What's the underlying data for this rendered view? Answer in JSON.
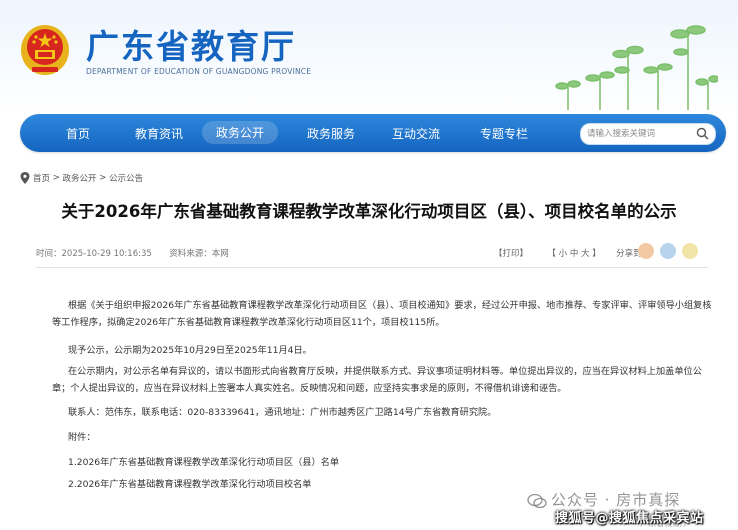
{
  "header": {
    "title": "广东省教育厅",
    "subtitle": "DEPARTMENT OF EDUCATION OF GUANGDONG PROVINCE",
    "brand_color": "#1565c0"
  },
  "nav": {
    "items": [
      "首页",
      "教育资讯",
      "政务公开",
      "政务服务",
      "互动交流",
      "专题专栏"
    ],
    "active": "政务公开",
    "search_placeholder": "请输入搜索关键词"
  },
  "breadcrumb": [
    "首页",
    "政务公开",
    "公示公告"
  ],
  "article": {
    "title": "关于2026年广东省基础教育课程教学改革深化行动项目区（县）、项目校名单的公示",
    "time": "时间：2025-10-29 10:16:35",
    "source": "资料来源：本网",
    "print": "【打印】",
    "font_size": "【 小  中  大 】",
    "share": "分享到：",
    "paragraphs": [
      "根据《关于组织申报2026年广东省基础教育课程教学改革深化行动项目区（县）、项目校通知》要求，经过公开申报、地市推荐、专家评审、评审领导小组复核等工作程序，拟确定2026年广东省基础教育课程教学改革深化行动项目区11个，项目校115所。",
      "现予公示，公示期为2025年10月29日至2025年11月4日。",
      "在公示期内，对公示名单有异议的，请以书面形式向省教育厅反映，并提供联系方式、异议事项证明材料等。单位提出异议的，应当在异议材料上加盖单位公章；个人提出异议的，应当在异议材料上签署本人真实姓名。反映情况和问题，应坚持实事求是的原则，不得借机诽谤和诬告。",
      "联系人：范伟东，联系电话：020-83339641，通讯地址：广州市越秀区广卫路14号广东省教育研究院。",
      "附件：",
      "1.2026年广东省基础教育课程教学改革深化行动项目区（县）名单",
      "2.2026年广东省基础教育课程教学改革深化行动项目校名单"
    ]
  },
  "watermarks": {
    "wechat": "公众号 · 房市真探",
    "sohu": "搜狐号@搜狐焦点采宾站",
    "bottom": "广东省教育厅"
  }
}
